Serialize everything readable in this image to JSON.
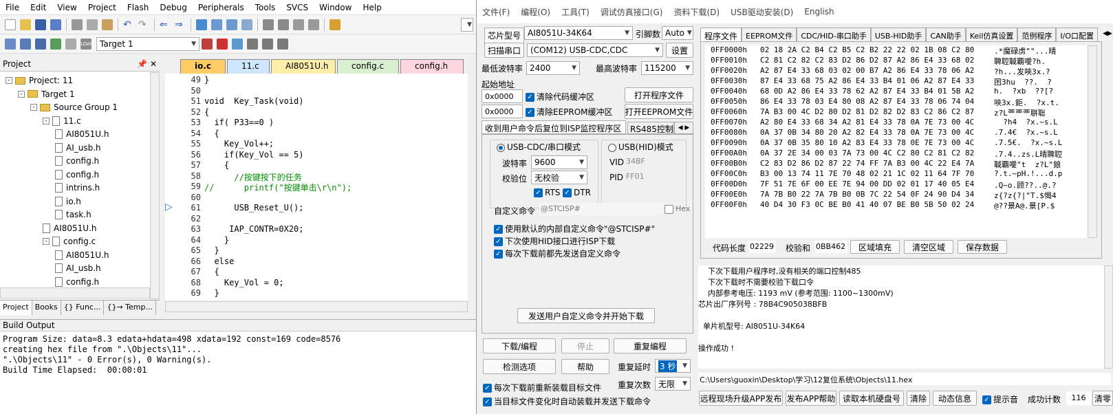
{
  "keil": {
    "menu": [
      "File",
      "Edit",
      "View",
      "Project",
      "Flash",
      "Debug",
      "Peripherals",
      "Tools",
      "SVCS",
      "Window",
      "Help"
    ],
    "target": "Target 1",
    "project_panel_title": "Project",
    "pin_icon": "pin-icon",
    "tree": [
      {
        "label": "Project: 11",
        "indent": 1,
        "type": "project",
        "exp": "-"
      },
      {
        "label": "Target 1",
        "indent": 2,
        "type": "folder",
        "exp": "-"
      },
      {
        "label": "Source Group 1",
        "indent": 3,
        "type": "folder",
        "exp": "-"
      },
      {
        "label": "11.c",
        "indent": 4,
        "type": "file",
        "exp": "-"
      },
      {
        "label": "AI8051U.h",
        "indent": 5,
        "type": "file",
        "exp": ""
      },
      {
        "label": "AI_usb.h",
        "indent": 5,
        "type": "file",
        "exp": ""
      },
      {
        "label": "config.h",
        "indent": 5,
        "type": "file",
        "exp": ""
      },
      {
        "label": "config.h",
        "indent": 5,
        "type": "file",
        "exp": ""
      },
      {
        "label": "intrins.h",
        "indent": 5,
        "type": "file",
        "exp": ""
      },
      {
        "label": "io.h",
        "indent": 5,
        "type": "file",
        "exp": ""
      },
      {
        "label": "task.h",
        "indent": 5,
        "type": "file",
        "exp": ""
      },
      {
        "label": "AI8051U.h",
        "indent": 4,
        "type": "file",
        "exp": ""
      },
      {
        "label": "config.c",
        "indent": 4,
        "type": "file",
        "exp": "-"
      },
      {
        "label": "AI8051U.h",
        "indent": 5,
        "type": "file",
        "exp": ""
      },
      {
        "label": "AI_usb.h",
        "indent": 5,
        "type": "file",
        "exp": ""
      },
      {
        "label": "config.h",
        "indent": 5,
        "type": "file",
        "exp": ""
      }
    ],
    "panel_tabs": [
      "Project",
      "Books",
      "{} Func...",
      "{}→ Temp..."
    ],
    "editor_tabs": [
      {
        "label": "io.c",
        "color": "#ffd27a",
        "active": true
      },
      {
        "label": "11.c",
        "color": "#cfe6ff",
        "active": false
      },
      {
        "label": "AI8051U.h",
        "color": "#ffeeaa",
        "active": false
      },
      {
        "label": "config.c",
        "color": "#d9efd0",
        "active": false
      },
      {
        "label": "config.h",
        "color": "#ffd6e0",
        "active": false
      }
    ],
    "code": [
      {
        "n": "49",
        "t": "}"
      },
      {
        "n": "50",
        "t": ""
      },
      {
        "n": "51",
        "t": "void  Key_Task(void)"
      },
      {
        "n": "52",
        "t": "{"
      },
      {
        "n": "53",
        "t": "  if( P33==0 )"
      },
      {
        "n": "54",
        "t": "  {"
      },
      {
        "n": "55",
        "t": "    Key_Vol++;"
      },
      {
        "n": "56",
        "t": "    if(Key_Vol == 5)"
      },
      {
        "n": "57",
        "t": "    {"
      },
      {
        "n": "58",
        "t": "      //按键按下的任务"
      },
      {
        "n": "59",
        "t": "//      printf(\"按键单击\\r\\n\");"
      },
      {
        "n": "60",
        "t": ""
      },
      {
        "n": "61",
        "t": "      USB_Reset_U();"
      },
      {
        "n": "62",
        "t": ""
      },
      {
        "n": "63",
        "t": "     IAP_CONTR=0X20;"
      },
      {
        "n": "64",
        "t": "    }"
      },
      {
        "n": "65",
        "t": "  }"
      },
      {
        "n": "66",
        "t": "  else"
      },
      {
        "n": "67",
        "t": "  {"
      },
      {
        "n": "68",
        "t": "    Key_Vol = 0;"
      },
      {
        "n": "69",
        "t": "  }"
      }
    ],
    "build_title": "Build Output",
    "build": [
      "Program Size: data=8.3 edata+hdata=498 xdata=192 const=169 code=8576",
      "creating hex file from \".\\Objects\\11\"...",
      "\".\\Objects\\11\" - 0 Error(s), 0 Warning(s).",
      "Build Time Elapsed:  00:00:01"
    ]
  },
  "isp": {
    "menu": [
      "文件(F)",
      "编程(O)",
      "工具(T)",
      "调试仿真接口(G)",
      "资料下载(D)",
      "USB驱动安装(D)",
      "English"
    ],
    "chip_label": "芯片型号",
    "chip": "AI8051U-34K64",
    "pin_label": "引脚数",
    "pin": "Auto",
    "scan_label": "扫描串口",
    "port": "(COM12) USB-CDC,CDC",
    "settings": "设置",
    "min_baud_label": "最低波特率",
    "min_baud": "2400",
    "max_baud_label": "最高波特率",
    "max_baud": "115200",
    "start_addr_label": "起始地址",
    "addr1": "0x0000",
    "clear_code": "清除代码缓冲区",
    "open_prog": "打开程序文件",
    "addr2": "0x0000",
    "clear_eeprom": "清除EEPROM缓冲区",
    "open_eeprom": "打开EEPROM文件",
    "reset_tab": "收到用户命令后复位到ISP监控程序区",
    "rs485_tab": "RS485控制",
    "cdc_mode": "USB-CDC/串口模式",
    "hid_mode": "USB(HID)模式",
    "baud_label": "波特率",
    "baud": "9600",
    "parity_label": "校验位",
    "parity": "无校验",
    "rts": "RTS",
    "dtr": "DTR",
    "vid_label": "VID",
    "vid": "34BF",
    "pid_label": "PID",
    "pid": "FF01",
    "custom_label": "自定义命令",
    "custom_value": "@STCISP#",
    "hex_label": "Hex",
    "opt1": "使用默认的内部自定义命令\"@STCISP#\"",
    "opt2": "下次使用HID接口进行ISP下载",
    "opt3": "每次下载前都先发送自定义命令",
    "send_btn": "发送用户自定义命令并开始下载",
    "download": "下载/编程",
    "stop": "停止",
    "reprogram": "重复编程",
    "check": "检测选项",
    "help": "帮助",
    "delay_label": "重复延时",
    "delay": "3 秒",
    "count_label": "重复次数",
    "count": "无限",
    "reload1": "每次下载前重新装载目标文件",
    "reload2": "当目标文件变化时自动装载并发送下载命令",
    "right_tabs": [
      "程序文件",
      "EEPROM文件",
      "CDC/HID-串口助手",
      "USB-HID助手",
      "CAN助手",
      "Keil仿真设置",
      "范例程序",
      "I/O口配置"
    ],
    "hex_rows": [
      {
        "a": "0FF0000h",
        "b": "02 18 2A C2 B4 C2 B5 C2 B2 22 22 02 1B 08 C2 80",
        "c": ".*魔碌虏\"\"...晴"
      },
      {
        "a": "0FF0010h",
        "b": "C2 81 C2 82 C2 83 D2 86 D2 87 A2 86 E4 33 68 02",
        "c": "聛聜聝覇噯?h."
      },
      {
        "a": "0FF0020h",
        "b": "A2 87 E4 33 68 03 02 00 B7 A2 86 E4 33 78 06 A2",
        "c": "?h...发唊3x.?"
      },
      {
        "a": "0FF0030h",
        "b": "87 E4 33 68 75 A2 86 E4 33 B4 01 06 A2 87 E4 33",
        "c": "囨3hu  ??.  ?"
      },
      {
        "a": "0FF0040h",
        "b": "68 0D A2 86 E4 33 78 62 A2 87 E4 33 B4 01 5B A2",
        "c": "h.  ?xb  ??[?"
      },
      {
        "a": "0FF0050h",
        "b": "86 E4 33 78 03 E4 80 08 A2 87 E4 33 78 06 74 04",
        "c": "唊3x.鉅.  ?x.t."
      },
      {
        "a": "0FF0060h",
        "b": "7A B3 00 4C D2 80 D2 81 D2 82 D2 83 C2 86 C2 87",
        "c": "z?L覀覀覀聠聡"
      },
      {
        "a": "0FF0070h",
        "b": "A2 80 E4 33 68 34 A2 81 E4 33 78 0A 7E 73 00 4C",
        "c": "  ?h4  ?x.~s.L"
      },
      {
        "a": "0FF0080h",
        "b": "0A 37 0B 34 80 20 A2 82 E4 33 78 0A 7E 73 00 4C",
        "c": ".7.4€  ?x.~s.L"
      },
      {
        "a": "0FF0090h",
        "b": "0A 37 0B 35 80 10 A2 83 E4 33 78 0E 7E 73 00 4C",
        "c": ".7.5€.  ?x.~s.L"
      },
      {
        "a": "0FF00A0h",
        "b": "0A 37 2E 34 00 03 7A 73 00 4C C2 80 C2 81 C2 82",
        "c": ".7.4..zs.L晴聛聜"
      },
      {
        "a": "0FF00B0h",
        "b": "C2 83 D2 86 D2 87 22 74 FF 7A B3 00 4C 22 E4 7A",
        "c": "聝覇噯\"t  z?L\"鋃"
      },
      {
        "a": "0FF00C0h",
        "b": "B3 00 13 74 11 7E 70 48 02 21 1C 02 11 64 7F 70",
        "c": "?.t.~pH.!...d.p"
      },
      {
        "a": "0FF00D0h",
        "b": "7F 51 7E 6F 00 EE 7E 94 00 DD 02 01 17 40 05 E4",
        "c": ".Q~o.顾??..@.?"
      },
      {
        "a": "0FF00E0h",
        "b": "7A 7B B0 22 7A 7B B0 0B 7C 22 54 0F 24 90 D4 34",
        "c": "z{?z{?|\"T.$愒4"
      },
      {
        "a": "0FF00F0h",
        "b": "40 D4 30 F3 0C BE B0 41 40 07 BE B0 5B 50 02 24",
        "c": "@??景A@.景[P.$"
      }
    ],
    "code_len_label": "代码长度",
    "code_len": "02229",
    "checksum_label": "校验和",
    "checksum": "0BB462",
    "fill_btn": "区域填充",
    "clear_btn": "清空区域",
    "save_btn": "保存数据",
    "log": [
      "    下次下载用户程序时,没有相关的端口控制485",
      "    下次下载时不需要校验下载口令",
      "    内部参考电压: 1193 mV (参考范围: 1100~1300mV)",
      "芯片出厂序列号 : 78B4C905038BFB",
      "",
      "  单片机型号: AI8051U-34K64",
      "",
      "操作成功 !"
    ],
    "path": "C:\\Users\\guoxin\\Desktop\\学习\\12复位系统\\Objects\\11.hex",
    "bottom": {
      "remote": "远程现场升级APP发布",
      "publish": "发布APP帮助",
      "read": "读取本机硬盘号",
      "clear": "清除",
      "dynamic": "动态信息",
      "beep": "提示音",
      "success_label": "成功计数",
      "success": "116",
      "clear2": "清零"
    }
  }
}
